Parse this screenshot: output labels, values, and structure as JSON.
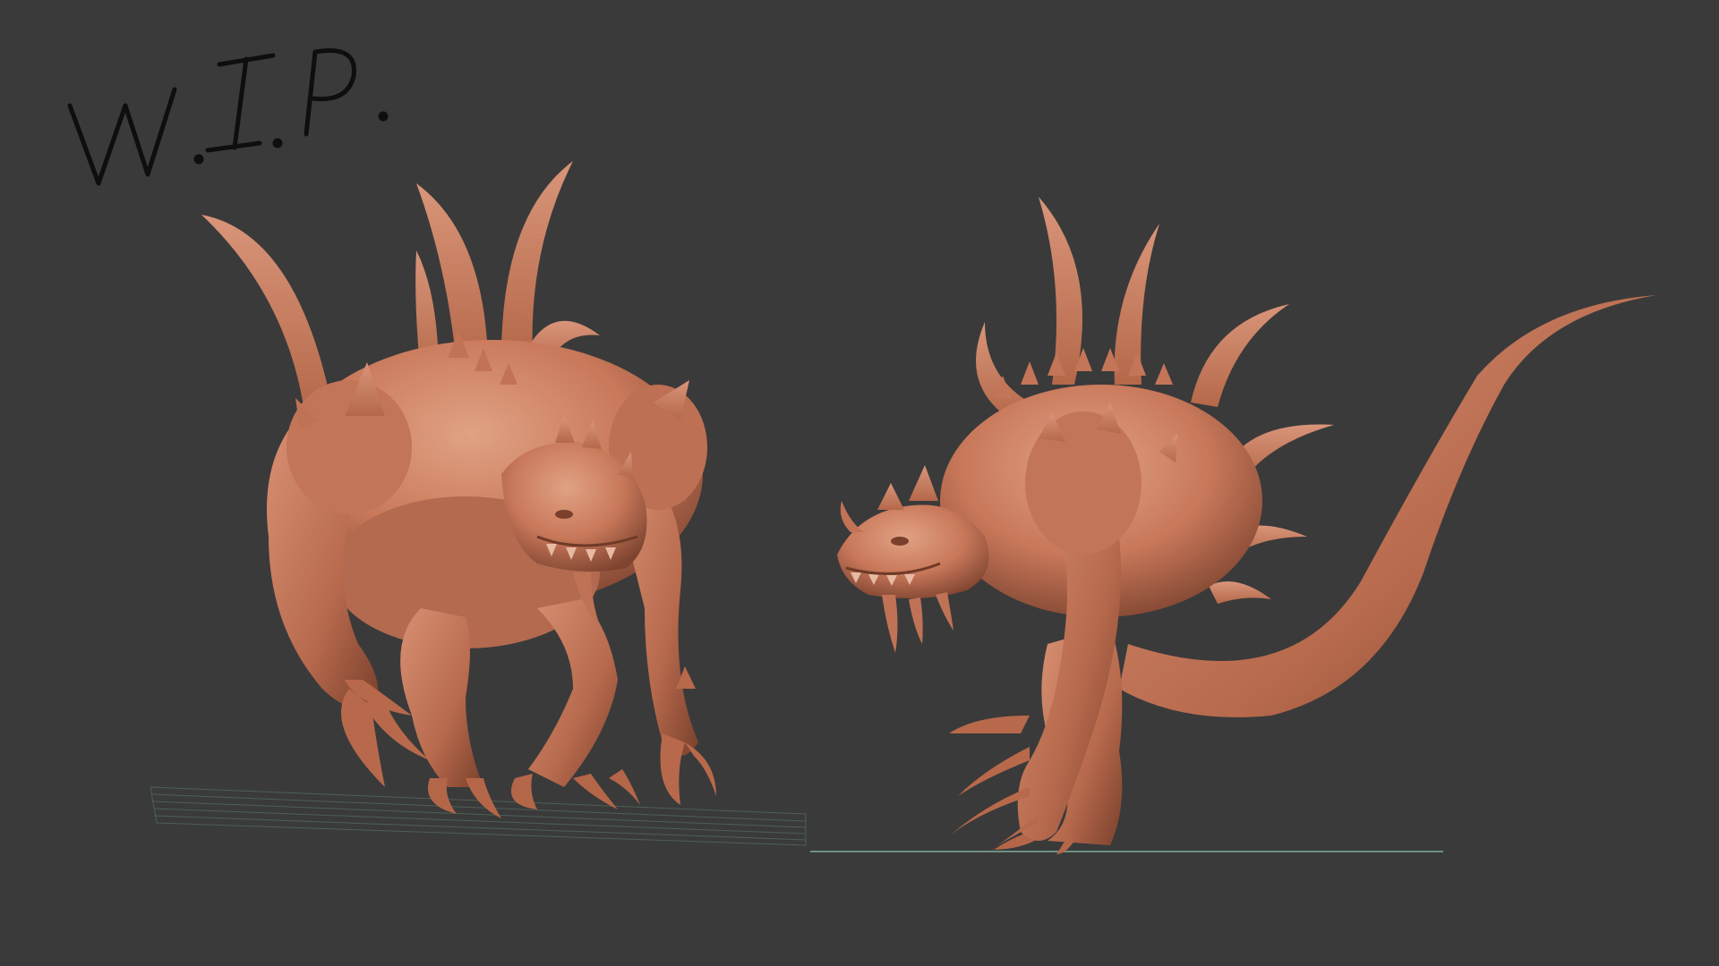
{
  "annotation": {
    "handwritten_label": "W.I.P."
  },
  "viewport": {
    "background_color": "#3a3a3a",
    "material_color": "#c9785a",
    "material_shadow_color": "#8a4a33",
    "material_highlight_color": "#dc9a7c",
    "grid_color": "#5b7a6e"
  },
  "models": [
    {
      "name": "creature-front-view"
    },
    {
      "name": "creature-side-view"
    }
  ]
}
